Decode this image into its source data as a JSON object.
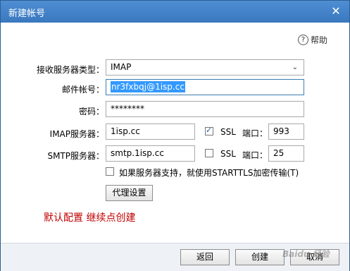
{
  "window": {
    "title": "新建帐号",
    "close_glyph": "✕"
  },
  "help": {
    "icon_glyph": "?",
    "label": "帮助"
  },
  "form": {
    "server_type_label": "接收服务器类型：",
    "server_type_value": "IMAP",
    "account_label": "邮件帐号：",
    "account_value": "nr3fxbqj@1isp.cc",
    "password_label": "密码：",
    "password_value": "********",
    "imap_label": "IMAP服务器：",
    "imap_value": "1isp.cc",
    "imap_ssl_label": "SSL",
    "imap_ssl_checked": true,
    "imap_port_label": "端口：",
    "imap_port_value": "993",
    "smtp_label": "SMTP服务器：",
    "smtp_value": "smtp.1isp.cc",
    "smtp_ssl_label": "SSL",
    "smtp_ssl_checked": false,
    "smtp_port_label": "端口：",
    "smtp_port_value": "25",
    "starttls_label": "如果服务器支持，就使用STARTTLS加密传输(T)",
    "starttls_checked": false,
    "proxy_button": "代理设置"
  },
  "annotation": {
    "text": "默认配置   继续点创建",
    "color": "#c00000"
  },
  "footer": {
    "back_button": "返回",
    "create_button": "创建",
    "cancel_button": "取消"
  },
  "watermark": {
    "text": "Baidu 经验"
  }
}
